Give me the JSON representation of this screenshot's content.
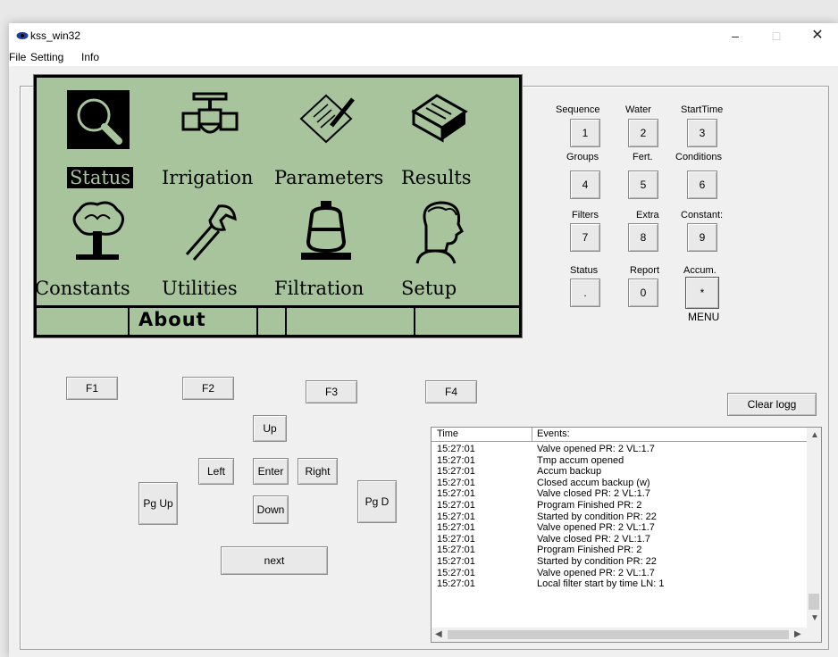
{
  "window": {
    "title": "kss_win32",
    "minimize": "–",
    "maximize": "□",
    "close": "✕"
  },
  "menu": [
    "File",
    "Setting",
    "Info"
  ],
  "lcd": {
    "items": [
      {
        "label": "Status",
        "icon": "magnifier-icon",
        "selected": true
      },
      {
        "label": "Irrigation",
        "icon": "valve-icon"
      },
      {
        "label": "Parameters",
        "icon": "document-pen-icon"
      },
      {
        "label": "Results",
        "icon": "printer-icon"
      },
      {
        "label": "Constants",
        "icon": "tree-icon"
      },
      {
        "label": "Utilities",
        "icon": "wrench-icon"
      },
      {
        "label": "Filtration",
        "icon": "filter-icon"
      },
      {
        "label": "Setup",
        "icon": "head-icon"
      }
    ],
    "bar_label": "About",
    "bg_color": "#a7c49c"
  },
  "keypad": {
    "labels": [
      "Sequence",
      "Water",
      "StartTime",
      "Groups",
      "Fert.",
      "Conditions",
      "Filters",
      "Extra",
      "Constant:",
      "Status",
      "Report",
      "Accum."
    ],
    "keys": [
      "1",
      "2",
      "3",
      "4",
      "5",
      "6",
      "7",
      "8",
      "9",
      ".",
      "0",
      "*"
    ],
    "menu_label": "MENU"
  },
  "fkeys": [
    "F1",
    "F2",
    "F3",
    "F4"
  ],
  "nav": {
    "up": "Up",
    "left": "Left",
    "enter": "Enter",
    "right": "Right",
    "down": "Down",
    "pgup": "Pg Up",
    "pgd": "Pg D",
    "next": "next"
  },
  "clear_log": "Clear logg",
  "log": {
    "headers": [
      "Time",
      "Events:"
    ],
    "rows": [
      [
        "15:27:01",
        "Valve opened PR: 2 VL:1.7"
      ],
      [
        "15:27:01",
        "Tmp accum opened"
      ],
      [
        "15:27:01",
        "Accum backup"
      ],
      [
        "15:27:01",
        "Closed accum backup (w)"
      ],
      [
        "15:27:01",
        "Valve closed PR: 2 VL:1.7"
      ],
      [
        "15:27:01",
        "Program Finished PR: 2"
      ],
      [
        "15:27:01",
        "Started by condition   PR: 22"
      ],
      [
        "15:27:01",
        "Valve opened PR: 2 VL:1.7"
      ],
      [
        "15:27:01",
        "Valve closed PR: 2 VL:1.7"
      ],
      [
        "15:27:01",
        "Program Finished PR: 2"
      ],
      [
        "15:27:01",
        "Started by condition   PR: 22"
      ],
      [
        "15:27:01",
        "Valve opened PR: 2 VL:1.7"
      ],
      [
        "15:27:01",
        "Local filter start by time LN: 1"
      ]
    ]
  }
}
